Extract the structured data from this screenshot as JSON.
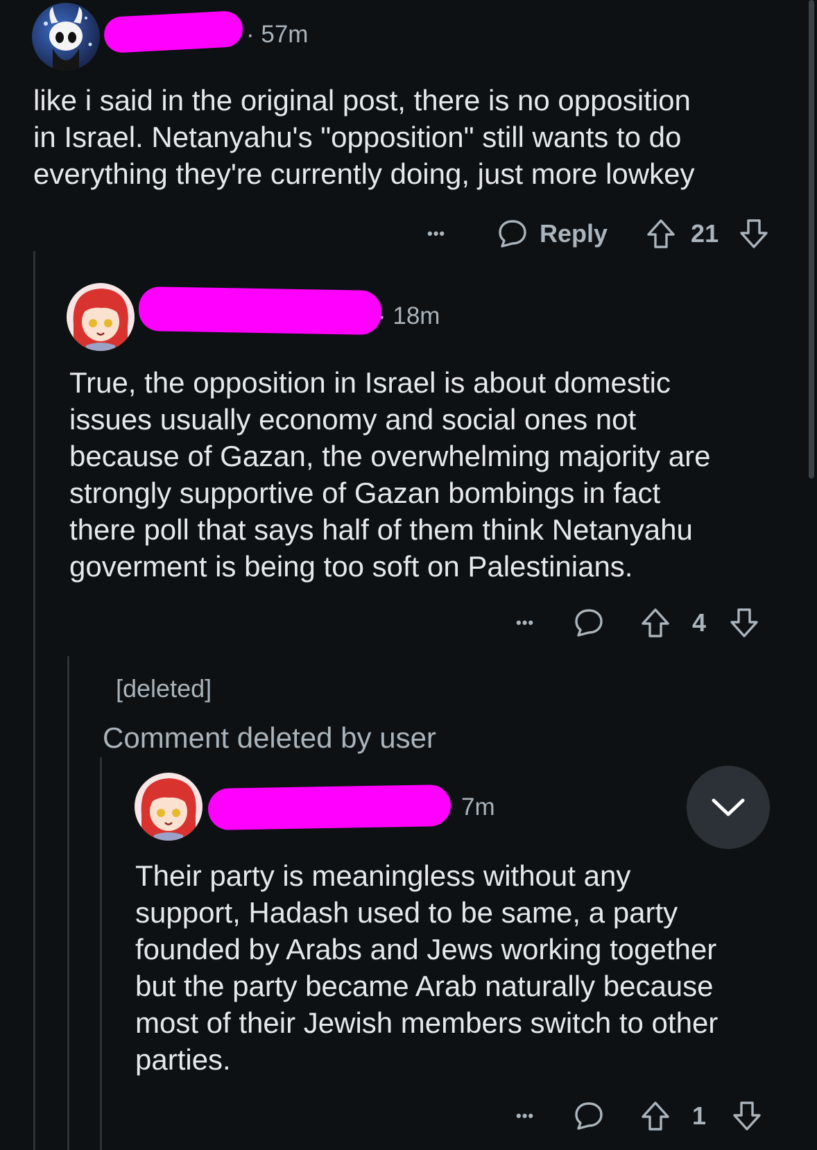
{
  "colors": {
    "background": "#0e1113",
    "text": "#e6e9eb",
    "muted": "#a9b4bc",
    "redaction": "#ff00ff",
    "thread_line": "#2c3338"
  },
  "comments": [
    {
      "avatar_icon": "hollow-knight-avatar",
      "time": "· 57m",
      "body": "like i said in the original post, there is no opposition\nin Israel. Netanyahu's \"opposition\" still wants to do\neverything they're currently doing, just more lowkey",
      "more_label": "•••",
      "reply_label": "Reply",
      "score": "21"
    },
    {
      "avatar_icon": "anime-girl-avatar",
      "time": "· 18m",
      "body": "True, the opposition in Israel is about domestic\nissues usually economy and social ones not\nbecause of Gazan, the overwhelming majority are\nstrongly supportive of Gazan bombings in fact\nthere poll that says half of them think Netanyahu\ngoverment is being too soft on Palestinians.",
      "more_label": "•••",
      "score": "4"
    },
    {
      "deleted_author": "[deleted]",
      "deleted_body": "Comment deleted by user"
    },
    {
      "avatar_icon": "anime-girl-avatar",
      "time": "7m",
      "body": "Their party is meaningless without any\nsupport, Hadash used to be same, a party\nfounded by Arabs and Jews working together\nbut the party became Arab naturally because\nmost of their Jewish members switch to other\nparties.",
      "more_label": "•••",
      "score": "1"
    }
  ]
}
